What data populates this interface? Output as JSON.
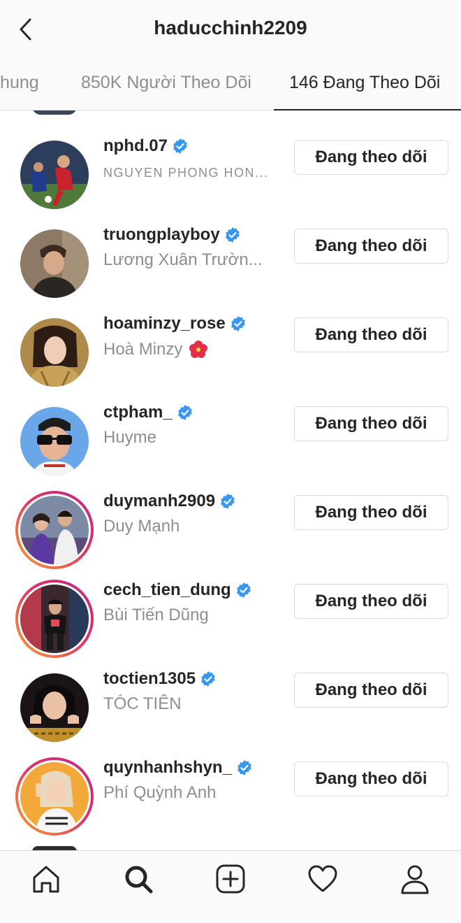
{
  "header": {
    "title": "haducchinh2209",
    "back_icon": "chevron-left-icon"
  },
  "tabs": [
    {
      "label": "Chung",
      "active": false
    },
    {
      "label": "850K Người Theo Dõi",
      "active": false
    },
    {
      "label": "146 Đang Theo Dõi",
      "active": true
    }
  ],
  "accounts": [
    {
      "username": "nphd.07",
      "full_name": "NGUYEN PHONG HON...",
      "verified": true,
      "story_ring": false,
      "button": "Đang theo dõi"
    },
    {
      "username": "truongplayboy",
      "full_name": "Lương Xuân Trườn...",
      "verified": true,
      "story_ring": false,
      "button": "Đang theo dõi"
    },
    {
      "username": "hoaminzy_rose",
      "full_name": "Hoà Minzy",
      "name_emoji": "hibiscus-icon",
      "verified": true,
      "story_ring": false,
      "button": "Đang theo dõi"
    },
    {
      "username": "ctpham_",
      "full_name": "Huyme",
      "verified": true,
      "story_ring": false,
      "button": "Đang theo dõi"
    },
    {
      "username": "duymanh2909",
      "full_name": "Duy Mạnh",
      "verified": true,
      "story_ring": true,
      "button": "Đang theo dõi"
    },
    {
      "username": "cech_tien_dung",
      "full_name": "Bùi Tiến Dũng",
      "verified": true,
      "story_ring": true,
      "button": "Đang theo dõi"
    },
    {
      "username": "toctien1305",
      "full_name": "TÓC TIÊN",
      "verified": true,
      "story_ring": false,
      "button": "Đang theo dõi"
    },
    {
      "username": "quynhanhshyn_",
      "full_name": "Phí Quỳnh Anh",
      "verified": true,
      "story_ring": true,
      "button": "Đang theo dõi"
    }
  ],
  "bottom_nav": [
    "home-icon",
    "search-icon",
    "new-post-icon",
    "activity-heart-icon",
    "profile-icon"
  ],
  "colors": {
    "verified": "#3897f0",
    "text": "#262626",
    "secondary": "#8e8e8e",
    "border": "#dbdbdb"
  }
}
